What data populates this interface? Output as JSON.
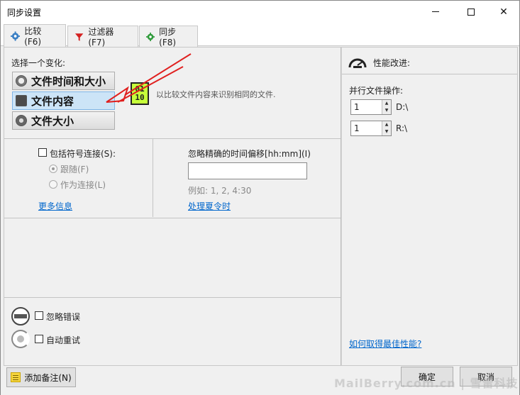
{
  "window": {
    "title": "同步设置",
    "minimize_icon": "minimize-icon",
    "maximize_icon": "maximize-icon",
    "close_glyph": "✕"
  },
  "tabs": [
    {
      "label": "比较 (F6)",
      "icon": "gear-icon"
    },
    {
      "label": "过滤器 (F7)",
      "icon": "funnel-icon"
    },
    {
      "label": "同步 (F8)",
      "icon": "gear-icon"
    }
  ],
  "compare": {
    "choose_label": "选择一个变化:",
    "variants": [
      {
        "label": "文件时间和大小",
        "icon": "clock-icon"
      },
      {
        "label": "文件内容",
        "icon": "binary-icon"
      },
      {
        "label": "文件大小",
        "icon": "info-icon"
      }
    ],
    "binary_glyph_top": "01",
    "binary_glyph_bottom": "10",
    "description": "以比较文件内容来识别相同的文件.",
    "symlinks_label": "包括符号连接(S):",
    "follow_label": "跟随(F)",
    "as_link_label": "作为连接(L)",
    "more_info_link": "更多信息",
    "time_shift_label": "忽略精确的时间偏移[hh:mm](I)",
    "time_shift_value": "",
    "example_label": "例如: 1, 2, 4:30",
    "dst_link": "处理夏令时",
    "ignore_errors_label": "忽略错误",
    "auto_retry_label": "自动重试"
  },
  "performance": {
    "title": "性能改进:",
    "parallel_label": "并行文件操作:",
    "rows": [
      {
        "value": "1",
        "drive": "D:\\"
      },
      {
        "value": "1",
        "drive": "R:\\"
      }
    ],
    "spin_up": "▲",
    "spin_down": "▼",
    "best_perf_link": "如何取得最佳性能?"
  },
  "footer": {
    "add_note_label": "添加备注(N)",
    "ok_label": "确定",
    "cancel_label": "取消"
  },
  "watermark": "MailBerry.com.cn | 雪雷科技",
  "colors": {
    "accent": "#0066cc",
    "selected_bg": "#cce4f7",
    "binary_icon": "#c6ff3a",
    "arrow": "#e0201f"
  }
}
